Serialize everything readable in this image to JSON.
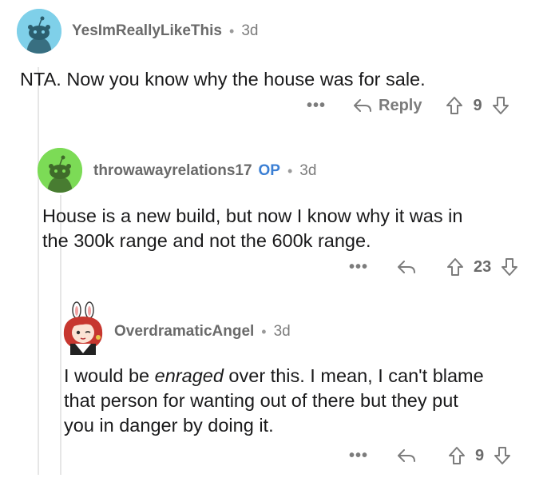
{
  "comments": [
    {
      "username": "YesImReallyLikeThis",
      "op_badge": "",
      "dot": "•",
      "time": "3d",
      "body": "NTA. Now you know why the house was for sale.",
      "more": "•••",
      "reply_label": "Reply",
      "votes": "9",
      "avatar_color": "#7fd0e9"
    },
    {
      "username": "throwawayrelations17",
      "op_badge": "OP",
      "dot": "•",
      "time": "3d",
      "body_line1": "House is a new build, but now I know why it was in",
      "body_line2": "the 300k range and not the 600k range.",
      "more": "•••",
      "votes": "23",
      "avatar_color": "#7cdb56"
    },
    {
      "username": "OverdramaticAngel",
      "dot": "•",
      "time": "3d",
      "body_pre": "I would be ",
      "body_em": "enraged",
      "body_line1_post": " over this. I mean, I can't blame",
      "body_line2": "that person for wanting out of there but they put",
      "body_line3": "you in danger by doing it.",
      "more": "•••",
      "votes": "9"
    }
  ],
  "colors": {
    "thread_line": "#e6e6e6",
    "op_blue": "#3b7fd4",
    "meta_gray": "#7c7c7c"
  }
}
